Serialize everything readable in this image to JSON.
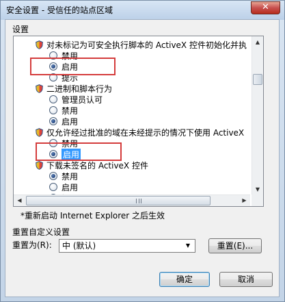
{
  "window": {
    "title": "安全设置 - 受信任的站点区域",
    "close_glyph": "✕"
  },
  "settings": {
    "section_label": "设置",
    "items": [
      {
        "kind": "head",
        "text": "对未标记为可安全执行脚本的 ActiveX 控件初始化并执"
      },
      {
        "kind": "opt",
        "text": "禁用",
        "checked": false
      },
      {
        "kind": "opt",
        "text": "启用",
        "checked": true
      },
      {
        "kind": "opt",
        "text": "提示",
        "checked": false
      },
      {
        "kind": "head",
        "text": "二进制和脚本行为"
      },
      {
        "kind": "opt",
        "text": "管理员认可",
        "checked": false
      },
      {
        "kind": "opt",
        "text": "禁用",
        "checked": false
      },
      {
        "kind": "opt",
        "text": "启用",
        "checked": true
      },
      {
        "kind": "head",
        "text": "仅允许经过批准的域在未经提示的情况下使用 ActiveX"
      },
      {
        "kind": "opt",
        "text": "禁用",
        "checked": false
      },
      {
        "kind": "opt",
        "text": "启用",
        "checked": true,
        "selected": true
      },
      {
        "kind": "head",
        "text": "下载未签名的 ActiveX 控件"
      },
      {
        "kind": "opt",
        "text": "禁用",
        "checked": true
      },
      {
        "kind": "opt",
        "text": "启用",
        "checked": false
      },
      {
        "kind": "opt",
        "text": "提示",
        "checked": false
      }
    ],
    "note": "*重新启动 Internet Explorer 之后生效"
  },
  "reset": {
    "group_title": "重置自定义设置",
    "label": "重置为(R):",
    "selected_value": "中 (默认)",
    "button": "重置(E)..."
  },
  "footer": {
    "ok": "确定",
    "cancel": "取消"
  },
  "colors": {
    "highlight_box": "#d43b3b",
    "selection": "#3399ff"
  }
}
